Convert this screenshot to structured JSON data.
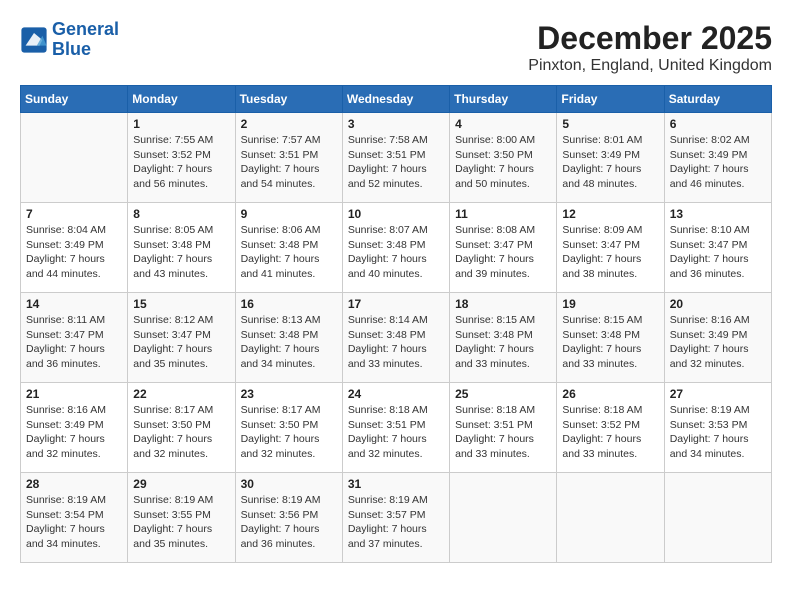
{
  "header": {
    "logo_line1": "General",
    "logo_line2": "Blue",
    "title": "December 2025",
    "subtitle": "Pinxton, England, United Kingdom"
  },
  "days_of_week": [
    "Sunday",
    "Monday",
    "Tuesday",
    "Wednesday",
    "Thursday",
    "Friday",
    "Saturday"
  ],
  "weeks": [
    [
      {
        "day": "",
        "text": ""
      },
      {
        "day": "1",
        "text": "Sunrise: 7:55 AM\nSunset: 3:52 PM\nDaylight: 7 hours\nand 56 minutes."
      },
      {
        "day": "2",
        "text": "Sunrise: 7:57 AM\nSunset: 3:51 PM\nDaylight: 7 hours\nand 54 minutes."
      },
      {
        "day": "3",
        "text": "Sunrise: 7:58 AM\nSunset: 3:51 PM\nDaylight: 7 hours\nand 52 minutes."
      },
      {
        "day": "4",
        "text": "Sunrise: 8:00 AM\nSunset: 3:50 PM\nDaylight: 7 hours\nand 50 minutes."
      },
      {
        "day": "5",
        "text": "Sunrise: 8:01 AM\nSunset: 3:49 PM\nDaylight: 7 hours\nand 48 minutes."
      },
      {
        "day": "6",
        "text": "Sunrise: 8:02 AM\nSunset: 3:49 PM\nDaylight: 7 hours\nand 46 minutes."
      }
    ],
    [
      {
        "day": "7",
        "text": "Sunrise: 8:04 AM\nSunset: 3:49 PM\nDaylight: 7 hours\nand 44 minutes."
      },
      {
        "day": "8",
        "text": "Sunrise: 8:05 AM\nSunset: 3:48 PM\nDaylight: 7 hours\nand 43 minutes."
      },
      {
        "day": "9",
        "text": "Sunrise: 8:06 AM\nSunset: 3:48 PM\nDaylight: 7 hours\nand 41 minutes."
      },
      {
        "day": "10",
        "text": "Sunrise: 8:07 AM\nSunset: 3:48 PM\nDaylight: 7 hours\nand 40 minutes."
      },
      {
        "day": "11",
        "text": "Sunrise: 8:08 AM\nSunset: 3:47 PM\nDaylight: 7 hours\nand 39 minutes."
      },
      {
        "day": "12",
        "text": "Sunrise: 8:09 AM\nSunset: 3:47 PM\nDaylight: 7 hours\nand 38 minutes."
      },
      {
        "day": "13",
        "text": "Sunrise: 8:10 AM\nSunset: 3:47 PM\nDaylight: 7 hours\nand 36 minutes."
      }
    ],
    [
      {
        "day": "14",
        "text": "Sunrise: 8:11 AM\nSunset: 3:47 PM\nDaylight: 7 hours\nand 36 minutes."
      },
      {
        "day": "15",
        "text": "Sunrise: 8:12 AM\nSunset: 3:47 PM\nDaylight: 7 hours\nand 35 minutes."
      },
      {
        "day": "16",
        "text": "Sunrise: 8:13 AM\nSunset: 3:48 PM\nDaylight: 7 hours\nand 34 minutes."
      },
      {
        "day": "17",
        "text": "Sunrise: 8:14 AM\nSunset: 3:48 PM\nDaylight: 7 hours\nand 33 minutes."
      },
      {
        "day": "18",
        "text": "Sunrise: 8:15 AM\nSunset: 3:48 PM\nDaylight: 7 hours\nand 33 minutes."
      },
      {
        "day": "19",
        "text": "Sunrise: 8:15 AM\nSunset: 3:48 PM\nDaylight: 7 hours\nand 33 minutes."
      },
      {
        "day": "20",
        "text": "Sunrise: 8:16 AM\nSunset: 3:49 PM\nDaylight: 7 hours\nand 32 minutes."
      }
    ],
    [
      {
        "day": "21",
        "text": "Sunrise: 8:16 AM\nSunset: 3:49 PM\nDaylight: 7 hours\nand 32 minutes."
      },
      {
        "day": "22",
        "text": "Sunrise: 8:17 AM\nSunset: 3:50 PM\nDaylight: 7 hours\nand 32 minutes."
      },
      {
        "day": "23",
        "text": "Sunrise: 8:17 AM\nSunset: 3:50 PM\nDaylight: 7 hours\nand 32 minutes."
      },
      {
        "day": "24",
        "text": "Sunrise: 8:18 AM\nSunset: 3:51 PM\nDaylight: 7 hours\nand 32 minutes."
      },
      {
        "day": "25",
        "text": "Sunrise: 8:18 AM\nSunset: 3:51 PM\nDaylight: 7 hours\nand 33 minutes."
      },
      {
        "day": "26",
        "text": "Sunrise: 8:18 AM\nSunset: 3:52 PM\nDaylight: 7 hours\nand 33 minutes."
      },
      {
        "day": "27",
        "text": "Sunrise: 8:19 AM\nSunset: 3:53 PM\nDaylight: 7 hours\nand 34 minutes."
      }
    ],
    [
      {
        "day": "28",
        "text": "Sunrise: 8:19 AM\nSunset: 3:54 PM\nDaylight: 7 hours\nand 34 minutes."
      },
      {
        "day": "29",
        "text": "Sunrise: 8:19 AM\nSunset: 3:55 PM\nDaylight: 7 hours\nand 35 minutes."
      },
      {
        "day": "30",
        "text": "Sunrise: 8:19 AM\nSunset: 3:56 PM\nDaylight: 7 hours\nand 36 minutes."
      },
      {
        "day": "31",
        "text": "Sunrise: 8:19 AM\nSunset: 3:57 PM\nDaylight: 7 hours\nand 37 minutes."
      },
      {
        "day": "",
        "text": ""
      },
      {
        "day": "",
        "text": ""
      },
      {
        "day": "",
        "text": ""
      }
    ]
  ]
}
